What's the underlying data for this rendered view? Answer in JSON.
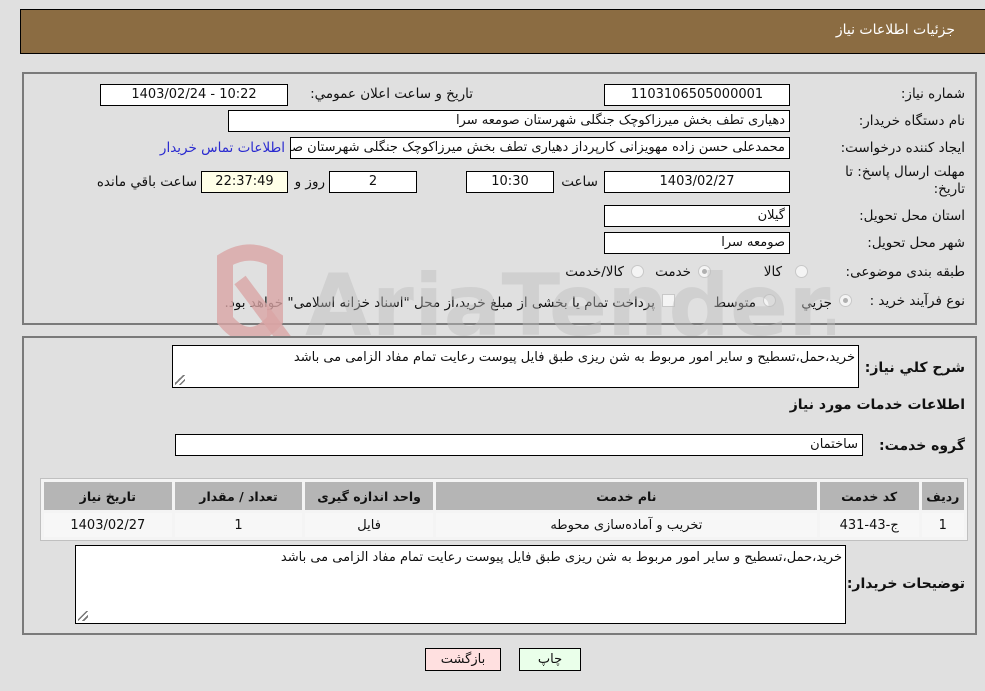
{
  "header": {
    "title": "جزئيات اطلاعات نياز"
  },
  "details": {
    "need_number_label": "شماره نياز:",
    "need_number": "1103106505000001",
    "announce_label": "تاريخ و ساعت اعلان عمومي:",
    "announce_value": "1403/02/24 - 10:22",
    "buyer_org_label": "نام دستگاه خريدار:",
    "buyer_org": "دهیاری تطف بخش میرزاکوچک جنگلی شهرستان صومعه سرا",
    "creator_label": "ايجاد كننده درخواست:",
    "creator": "محمدعلی حسن زاده مهویزانی کارپرداز دهیاری تطف بخش میرزاکوچک جنگلی شهرستان صومعه سرا",
    "contact_link": "اطلاعات تماس خريدار",
    "deadline_label": "مهلت ارسال پاسخ: تا تاريخ:",
    "deadline_date": "1403/02/27",
    "time_label": "ساعت",
    "deadline_time": "10:30",
    "days_value": "2",
    "days_label": "روز و",
    "remaining_time": "22:37:49",
    "remaining_label": "ساعت باقي مانده",
    "province_label": "استان محل تحويل:",
    "province": "گيلان",
    "city_label": "شهر محل تحويل:",
    "city": "صومعه سرا",
    "category_label": "طبقه بندی موضوعی:",
    "category_options": [
      {
        "label": "کالا",
        "checked": false
      },
      {
        "label": "خدمت",
        "checked": true
      },
      {
        "label": "کالا/خدمت",
        "checked": false
      }
    ],
    "process_label": "نوع فرآيند خريد :",
    "process_options": [
      {
        "label": "جزيي",
        "checked": true
      },
      {
        "label": "متوسط",
        "checked": false
      }
    ],
    "treasury_note": "پرداخت تمام يا بخشی از مبلغ خريد،از محل \"اسناد خزانه اسلامی\" خواهد بود."
  },
  "description": {
    "label": "شرح کلي نياز:",
    "value": "خريد،حمل،تسطيح و ساير امور مربوط به شن ريزی طبق فايل پيوست رعايت تمام مفاد الزامی می باشد"
  },
  "services": {
    "section_title": "اطلاعات خدمات مورد نياز",
    "group_label": "گروه خدمت:",
    "group_value": "ساختمان",
    "table": {
      "headers": [
        "رديف",
        "کد خدمت",
        "نام خدمت",
        "واحد اندازه گيری",
        "تعداد / مقدار",
        "تاريخ نياز"
      ],
      "rows": [
        [
          "1",
          "ج-43-431",
          "تخريب و آماده‌سازی محوطه",
          "فايل",
          "1",
          "1403/02/27"
        ]
      ]
    }
  },
  "buyer_notes": {
    "label": "توضيحات خريدار:",
    "value": "خريد،حمل،تسطيح و ساير امور مربوط به شن ريزی طبق فايل پيوست رعايت تمام مفاد الزامی می باشد"
  },
  "buttons": {
    "print": "چاپ",
    "back": "بازگشت"
  },
  "watermark": {
    "text": "AriaTender.neT"
  }
}
